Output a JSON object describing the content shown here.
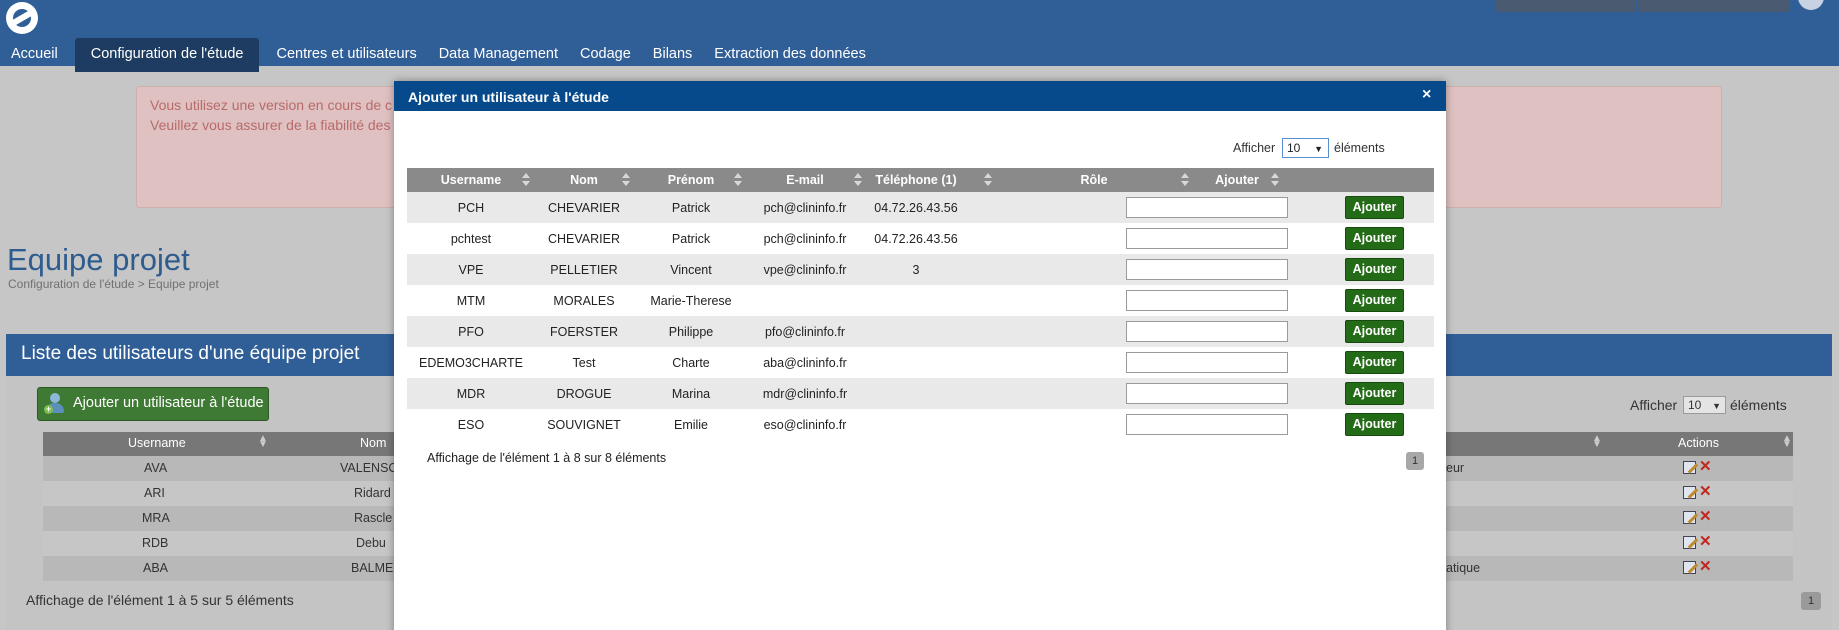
{
  "nav": {
    "items": [
      {
        "label": "Accueil"
      },
      {
        "label": "Configuration de l'étude",
        "active": true
      },
      {
        "label": "Centres et utilisateurs"
      },
      {
        "label": "Data Management"
      },
      {
        "label": "Codage"
      },
      {
        "label": "Bilans"
      },
      {
        "label": "Extraction des données"
      }
    ]
  },
  "warning": {
    "line1": "Vous utilisez une version en cours de c",
    "line2": "Veuillez vous assurer de la fiabilité des"
  },
  "page": {
    "title": "Equipe projet",
    "breadcrumb": "Configuration de l'étude > Equipe projet"
  },
  "panel": {
    "title": "Liste des utilisateurs d'une équipe projet",
    "add_button_label": "Ajouter un utilisateur à l'étude",
    "afficher_label": "Afficher",
    "page_size": "10",
    "elements_label": "éléments",
    "columns": {
      "username": "Username",
      "nom": "Nom",
      "actions": "Actions"
    },
    "rows": [
      {
        "username": "AVA",
        "nom": "VALENSC",
        "role": "eur"
      },
      {
        "username": "ARI",
        "nom": "Ridard",
        "role": ""
      },
      {
        "username": "MRA",
        "nom": "Rascle",
        "role": ""
      },
      {
        "username": "RDB",
        "nom": "Debu",
        "role": ""
      },
      {
        "username": "ABA",
        "nom": "BALME",
        "role": "atique"
      }
    ],
    "info": "Affichage de l'élément 1 à 5 sur 5 éléments",
    "current_page": "1"
  },
  "modal": {
    "title": "Ajouter un utilisateur à l'étude",
    "close": "×",
    "afficher_label": "Afficher",
    "page_size": "10",
    "elements_label": "éléments",
    "columns": {
      "username": "Username",
      "nom": "Nom",
      "prenom": "Prénom",
      "email": "E-mail",
      "telephone": "Téléphone (1)",
      "role": "Rôle",
      "ajouter": "Ajouter"
    },
    "add_label": "Ajouter",
    "rows": [
      {
        "username": "PCH",
        "nom": "CHEVARIER",
        "prenom": "Patrick",
        "email": "pch@clininfo.fr",
        "telephone": "04.72.26.43.56",
        "role": ""
      },
      {
        "username": "pchtest",
        "nom": "CHEVARIER",
        "prenom": "Patrick",
        "email": "pch@clininfo.fr",
        "telephone": "04.72.26.43.56",
        "role": ""
      },
      {
        "username": "VPE",
        "nom": "PELLETIER",
        "prenom": "Vincent",
        "email": "vpe@clininfo.fr",
        "telephone": "3",
        "role": ""
      },
      {
        "username": "MTM",
        "nom": "MORALES",
        "prenom": "Marie-Therese",
        "email": "",
        "telephone": "",
        "role": ""
      },
      {
        "username": "PFO",
        "nom": "FOERSTER",
        "prenom": "Philippe",
        "email": "pfo@clininfo.fr",
        "telephone": "",
        "role": ""
      },
      {
        "username": "EDEMO3CHARTE",
        "nom": "Test",
        "prenom": "Charte",
        "email": "aba@clininfo.fr",
        "telephone": "",
        "role": ""
      },
      {
        "username": "MDR",
        "nom": "DROGUE",
        "prenom": "Marina",
        "email": "mdr@clininfo.fr",
        "telephone": "",
        "role": ""
      },
      {
        "username": "ESO",
        "nom": "SOUVIGNET",
        "prenom": "Emilie",
        "email": "eso@clininfo.fr",
        "telephone": "",
        "role": ""
      }
    ],
    "info": "Affichage de l'élément 1 à 8 sur 8 éléments",
    "current_page": "1"
  },
  "icons": {
    "logo": "app-logo-icon",
    "close": "close-icon",
    "sort": "sort-icon",
    "edit": "edit-icon",
    "delete": "delete-icon",
    "add_user": "add-user-icon",
    "dropdown": "chevron-down-icon"
  },
  "colors": {
    "header": "#305e97",
    "modal_header": "#064a8c",
    "add_button": "#236b16",
    "warning_bg": "#dfc1c1",
    "warning_text": "#b86a6a"
  }
}
